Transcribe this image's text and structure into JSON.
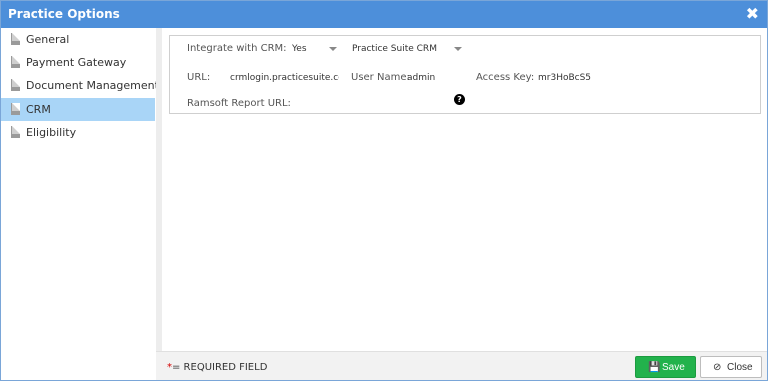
{
  "window": {
    "title": "Practice Options",
    "close_glyph": "✖"
  },
  "sidebar": {
    "items": [
      {
        "label": "General",
        "icon": "document-icon"
      },
      {
        "label": "Payment Gateway",
        "icon": "document-icon"
      },
      {
        "label": "Document Management",
        "icon": "document-icon"
      },
      {
        "label": "CRM",
        "icon": "document-icon",
        "active": true
      },
      {
        "label": "Eligibility",
        "icon": "document-icon"
      }
    ]
  },
  "crm": {
    "integrate_label": "Integrate with CRM:",
    "integrate_value": "Yes",
    "crm_provider": "Practice Suite CRM",
    "url_label": "URL:",
    "url_value": "crmlogin.practicesuite.co",
    "username_label": "User Name:",
    "username_value": "admin",
    "access_key_label": "Access Key:",
    "access_key_value": "mr3HoBcS5",
    "ramsoft_label": "Ramsoft Report URL:",
    "help_glyph": "?"
  },
  "footer": {
    "required_star": "*",
    "required_text": "= REQUIRED FIELD",
    "save_label": "Save",
    "close_label": "Close"
  },
  "colors": {
    "titlebar": "#4d8fda",
    "active_item": "#a9d5f7",
    "save_button": "#22b24c"
  }
}
